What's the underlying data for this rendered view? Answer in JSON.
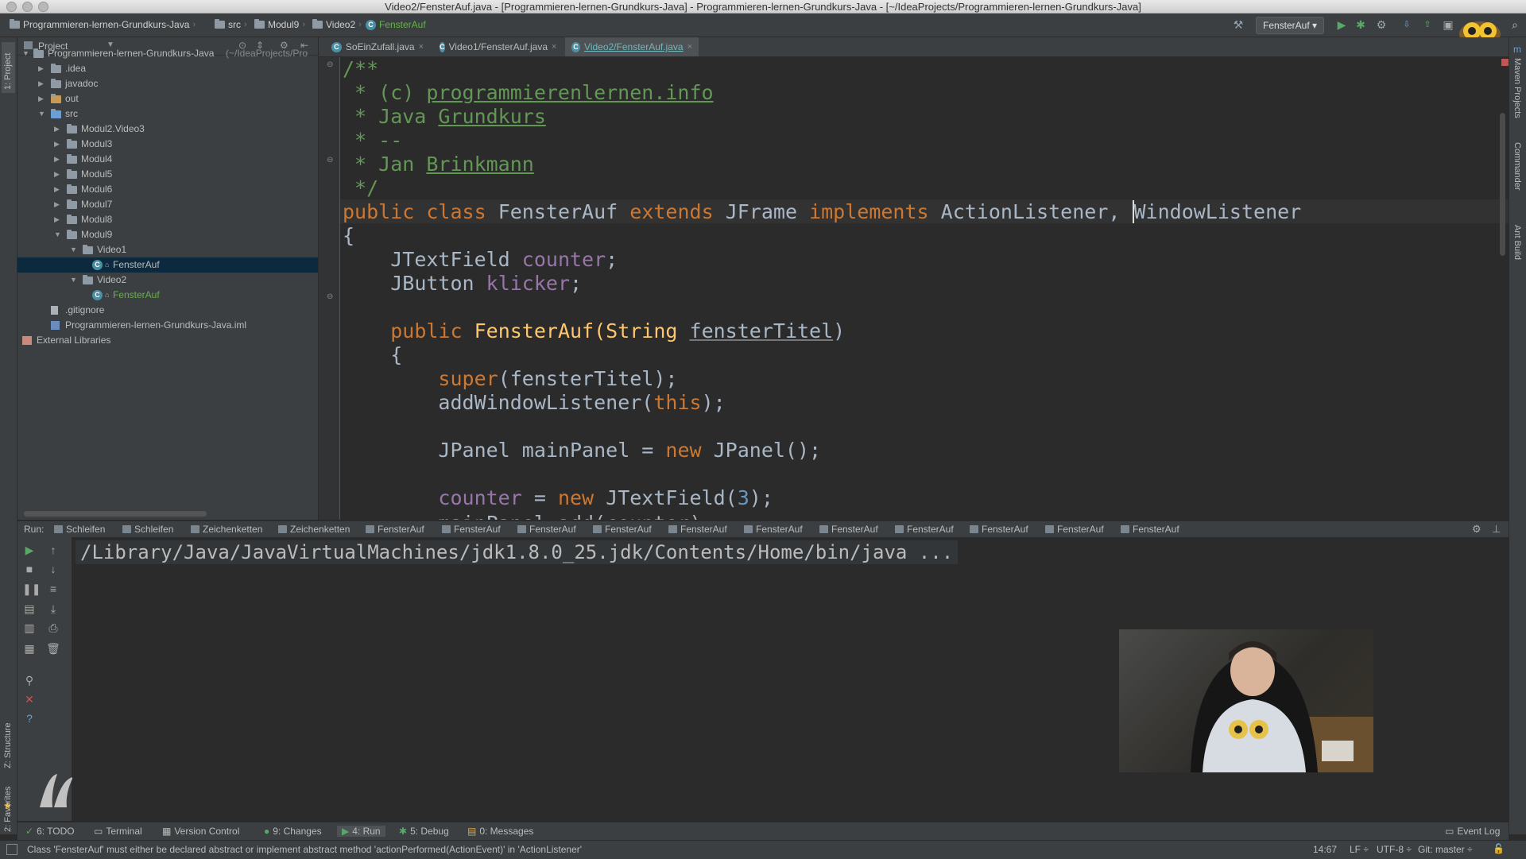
{
  "window": {
    "title": "Video2/FensterAuf.java - [Programmieren-lernen-Grundkurs-Java] - Programmieren-lernen-Grundkurs-Java - [~/IdeaProjects/Programmieren-lernen-Grundkurs-Java]"
  },
  "navbar": {
    "crumbs": [
      "Programmieren-lernen-Grundkurs-Java",
      "src",
      "Modul9",
      "Video2",
      "FensterAuf"
    ],
    "run_config": "FensterAuf"
  },
  "left_strip": {
    "project": "1: Project",
    "structure": "Z: Structure",
    "favorites": "2: Favorites"
  },
  "right_strip": {
    "maven": "Maven Projects",
    "commander": "Commander",
    "ant": "Ant Build"
  },
  "project": {
    "header": "Project",
    "root_name": "Programmieren-lernen-Grundkurs-Java",
    "root_path": "(~/IdeaProjects/Pro",
    "items": [
      {
        "label": ".idea",
        "type": "folder",
        "depth": 1,
        "arrow": "▶"
      },
      {
        "label": "javadoc",
        "type": "folder",
        "depth": 1,
        "arrow": "▶"
      },
      {
        "label": "out",
        "type": "folder-orange",
        "depth": 1,
        "arrow": "▶"
      },
      {
        "label": "src",
        "type": "folder-blue",
        "depth": 1,
        "arrow": "▼"
      },
      {
        "label": "Modul2.Video3",
        "type": "package",
        "depth": 2,
        "arrow": "▶"
      },
      {
        "label": "Modul3",
        "type": "package",
        "depth": 2,
        "arrow": "▶"
      },
      {
        "label": "Modul4",
        "type": "package",
        "depth": 2,
        "arrow": "▶"
      },
      {
        "label": "Modul5",
        "type": "package",
        "depth": 2,
        "arrow": "▶"
      },
      {
        "label": "Modul6",
        "type": "package",
        "depth": 2,
        "arrow": "▶"
      },
      {
        "label": "Modul7",
        "type": "package",
        "depth": 2,
        "arrow": "▶"
      },
      {
        "label": "Modul8",
        "type": "package",
        "depth": 2,
        "arrow": "▶"
      },
      {
        "label": "Modul9",
        "type": "package",
        "depth": 2,
        "arrow": "▼"
      },
      {
        "label": "Video1",
        "type": "package",
        "depth": 3,
        "arrow": "▼"
      },
      {
        "label": "FensterAuf",
        "type": "class",
        "depth": 4,
        "arrow": ""
      },
      {
        "label": "Video2",
        "type": "package",
        "depth": 3,
        "arrow": "▼"
      },
      {
        "label": "FensterAuf",
        "type": "class-green",
        "depth": 4,
        "arrow": ""
      },
      {
        "label": ".gitignore",
        "type": "file",
        "depth": 1,
        "arrow": ""
      },
      {
        "label": "Programmieren-lernen-Grundkurs-Java.iml",
        "type": "iml",
        "depth": 1,
        "arrow": ""
      },
      {
        "label": "External Libraries",
        "type": "lib",
        "depth": 0,
        "arrow": ""
      }
    ]
  },
  "tabs": [
    {
      "label": "SoEinZufall.java"
    },
    {
      "label": "Video1/FensterAuf.java"
    },
    {
      "label": "Video2/FensterAuf.java"
    }
  ],
  "code": {
    "l1": "/**",
    "l2a": " * (c) ",
    "l2b": "programmierenlernen.info",
    "l3a": " * Java ",
    "l3b": "Grundkurs",
    "l4": " * --",
    "l5a": " * Jan ",
    "l5b": "Brinkmann",
    "l6": " */",
    "l7_public": "public",
    "l7_class": "class",
    "l7_name": "FensterAuf",
    "l7_extends": "extends",
    "l7_super": "JFrame",
    "l7_impl": "implements",
    "l7_if1": "ActionListener,",
    "l7_if2": "WindowListener",
    "l8": "{",
    "l9_type": "JTextField",
    "l9_field": "counter",
    "l10_type": "JButton",
    "l10_field": "klicker",
    "l12_public": "public",
    "l12_name": "FensterAuf(String",
    "l12_param": "fensterTitel",
    "l12_end": ")",
    "l13": "{",
    "l14_super": "super",
    "l14_rest": "(fensterTitel);",
    "l15_call": "addWindowListener(",
    "l15_this": "this",
    "l15_end": ");",
    "l17_a": "JPanel mainPanel = ",
    "l17_new": "new",
    "l17_b": " JPanel();",
    "l19_field": "counter",
    "l19_a": " = ",
    "l19_new": "new",
    "l19_b": " JTextField(",
    "l19_num": "3",
    "l19_c": ");",
    "l20": "mainPanel.add(counter);"
  },
  "run": {
    "label": "Run:",
    "tabs": [
      "Schleifen",
      "Schleifen",
      "Zeichenketten",
      "Zeichenketten",
      "FensterAuf",
      "FensterAuf",
      "FensterAuf",
      "FensterAuf",
      "FensterAuf",
      "FensterAuf",
      "FensterAuf",
      "FensterAuf",
      "FensterAuf",
      "FensterAuf",
      "FensterAuf"
    ],
    "console_line": "/Library/Java/JavaVirtualMachines/jdk1.8.0_25.jdk/Contents/Home/bin/java ..."
  },
  "bottom_tools": {
    "todo": "6: TODO",
    "terminal": "Terminal",
    "vcs": "Version Control",
    "changes": "9: Changes",
    "run": "4: Run",
    "debug": "5: Debug",
    "messages": "0: Messages",
    "event_log": "Event Log"
  },
  "status": {
    "message": "Class 'FensterAuf' must either be declared abstract or implement abstract method 'actionPerformed(ActionEvent)' in 'ActionListener'",
    "position": "14:67",
    "line_sep": "LF ÷",
    "encoding": "UTF-8 ÷",
    "git": "Git: master ÷"
  },
  "colors": {
    "accent_green": "#62b543",
    "tab_active_text": "#6fb7bc",
    "selection": "#0d293e"
  }
}
